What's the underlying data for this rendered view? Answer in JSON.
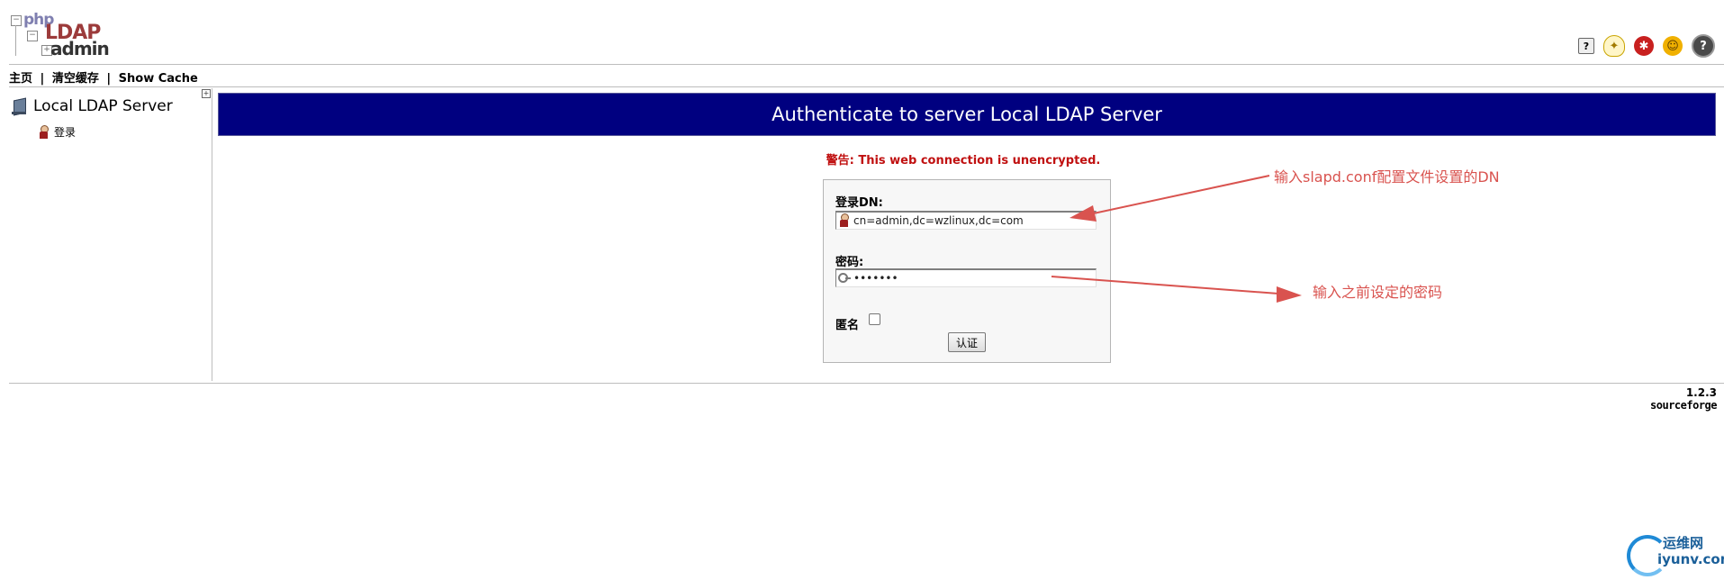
{
  "header": {
    "logo": {
      "php": "php",
      "ldap": "LDAP",
      "admin": "admin"
    },
    "icons": [
      "help-small-icon",
      "lightbulb-icon",
      "bug-icon",
      "smiley-icon",
      "help-icon"
    ]
  },
  "nav": {
    "home": "主页",
    "clear_cache": "清空缓存",
    "show_cache": "Show Cache",
    "separator": "|"
  },
  "tree": {
    "expand": "+",
    "server_name": "Local LDAP Server",
    "login_label": "登录"
  },
  "main": {
    "title": "Authenticate to server Local LDAP Server",
    "warning": "警告: This web connection is unencrypted.",
    "login_dn_label": "登录DN:",
    "login_dn_value": "cn=admin,dc=wzlinux,dc=com",
    "password_label": "密码:",
    "password_value": "•••••••",
    "anonymous_label": "匿名",
    "submit_label": "认证"
  },
  "annotations": {
    "dn_note": "输入slapd.conf配置文件设置的DN",
    "password_note": "输入之前设定的密码"
  },
  "footer": {
    "version": "1.2.3",
    "sourceforge": "sourceforge"
  },
  "watermark": {
    "cn": "运维网",
    "en": "iyunv.com"
  },
  "colors": {
    "title_bar": "#000080",
    "warning": "#c01010",
    "annotation": "#d9534f"
  }
}
